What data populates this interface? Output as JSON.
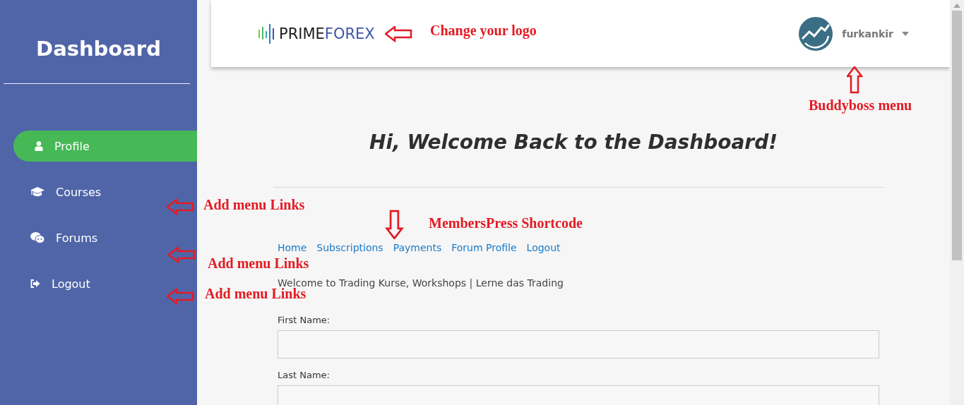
{
  "sidebar": {
    "title": "Dashboard",
    "items": [
      {
        "label": "Profile",
        "kind": "user",
        "selected": true
      },
      {
        "label": "Courses",
        "kind": "cap",
        "selected": false
      },
      {
        "label": "Forums",
        "kind": "chat",
        "selected": false
      },
      {
        "label": "Logout",
        "kind": "exit",
        "selected": false
      }
    ]
  },
  "header": {
    "logo": {
      "wordmark": [
        "PRIME",
        "FOREX"
      ]
    },
    "user": {
      "name": "furkankir"
    }
  },
  "heading": "Hi, Welcome Back to the Dashboard!",
  "account_nav": [
    "Home",
    "Subscriptions",
    "Payments",
    "Forum Profile",
    "Logout"
  ],
  "welcome": "Welcome to Trading Kurse, Workshops | Lerne das Trading",
  "form": {
    "fields": [
      {
        "label": "First Name:"
      },
      {
        "label": "Last Name:"
      }
    ]
  },
  "annotations": [
    {
      "text": "Change your logo",
      "kind": "left"
    },
    {
      "text": "Buddyboss menu",
      "kind": "up"
    },
    {
      "text": "Add menu Links",
      "kind": "left"
    },
    {
      "text": "Add menu Links",
      "kind": "left"
    },
    {
      "text": "Add menu Links",
      "kind": "left"
    },
    {
      "text": "MembersPress Shortcode",
      "kind": "down"
    }
  ]
}
